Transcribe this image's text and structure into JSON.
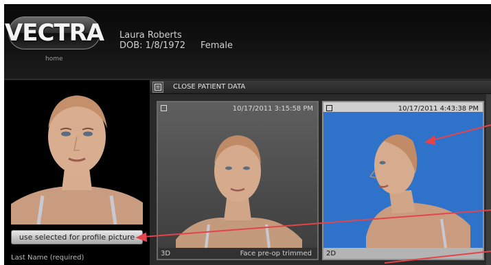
{
  "header": {
    "logo_text": "VECTRA",
    "home_label": "home",
    "patient_name": "Laura Roberts",
    "patient_dob": "DOB: 1/8/1972",
    "patient_sex": "Female"
  },
  "close_bar": {
    "label": "CLOSE PATIENT DATA"
  },
  "left_panel": {
    "profile_button_label": "use selected for profile picture",
    "last_name_label": "Last Name (required)"
  },
  "thumbnails": [
    {
      "timestamp": "10/17/2011 3:15:58 PM",
      "type": "3D",
      "caption": "Face pre-op trimmed"
    },
    {
      "timestamp": "10/17/2011 4:43:38 PM",
      "type": "2D",
      "caption": ""
    }
  ],
  "colors": {
    "accent_blue": "#2e73c9",
    "annotation_red": "#e3434b"
  }
}
